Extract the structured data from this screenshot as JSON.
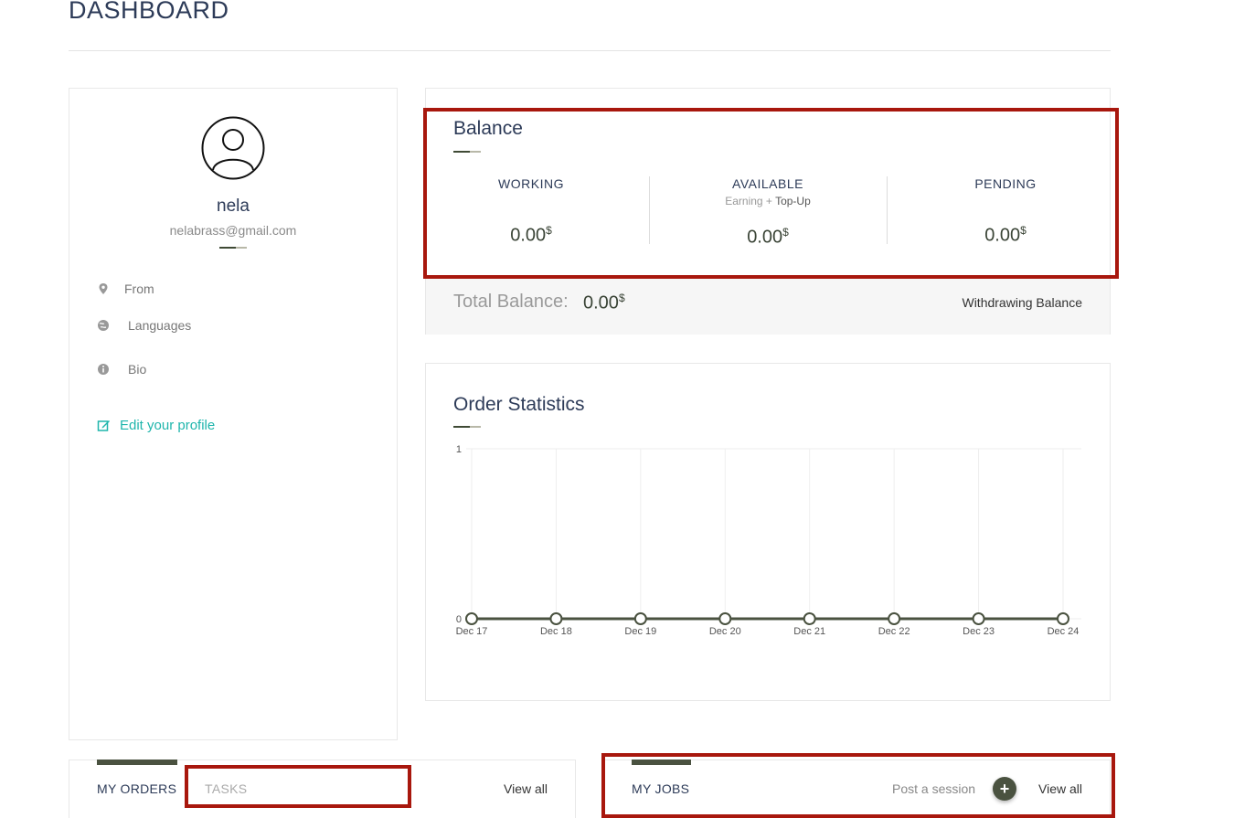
{
  "header": {
    "title": "DASHBOARD"
  },
  "profile": {
    "name": "nela",
    "email": "nelabrass@gmail.com",
    "fields": [
      {
        "label": "From",
        "icon": "map-marker-icon"
      },
      {
        "label": "Languages",
        "icon": "globe-icon"
      },
      {
        "label": "Bio",
        "icon": "info-circle-icon"
      }
    ],
    "edit_label": "Edit your profile"
  },
  "balance": {
    "title": "Balance",
    "working": {
      "label": "WORKING",
      "amount": "0.00",
      "currency": "$"
    },
    "available": {
      "label": "AVAILABLE",
      "sub_earning": "Earning +",
      "sub_topup": "Top-Up",
      "amount": "0.00",
      "currency": "$"
    },
    "pending": {
      "label": "PENDING",
      "amount": "0.00",
      "currency": "$"
    },
    "total_label": "Total Balance:",
    "total_amount": "0.00",
    "total_currency": "$",
    "withdraw_label": "Withdrawing Balance"
  },
  "stats": {
    "title": "Order Statistics"
  },
  "chart_data": {
    "type": "line",
    "title": "Order Statistics",
    "categories": [
      "Dec 17",
      "Dec 18",
      "Dec 19",
      "Dec 20",
      "Dec 21",
      "Dec 22",
      "Dec 23",
      "Dec 24"
    ],
    "series": [
      {
        "values": [
          0,
          0,
          0,
          0,
          0,
          0,
          0,
          0
        ]
      }
    ],
    "ylim": [
      0,
      1
    ],
    "yticks": [
      "0",
      "1"
    ],
    "grid": true,
    "color": "#4a5240"
  },
  "orders_panel": {
    "tab_orders": "MY ORDERS",
    "tab_tasks": "TASKS",
    "view_all": "View all"
  },
  "jobs_panel": {
    "tab_jobs": "MY JOBS",
    "post_session": "Post a session",
    "plus": "+",
    "view_all": "View all"
  },
  "colors": {
    "accent": "#4a5240",
    "link": "#1fb5ac",
    "highlight": "#a8170d"
  }
}
